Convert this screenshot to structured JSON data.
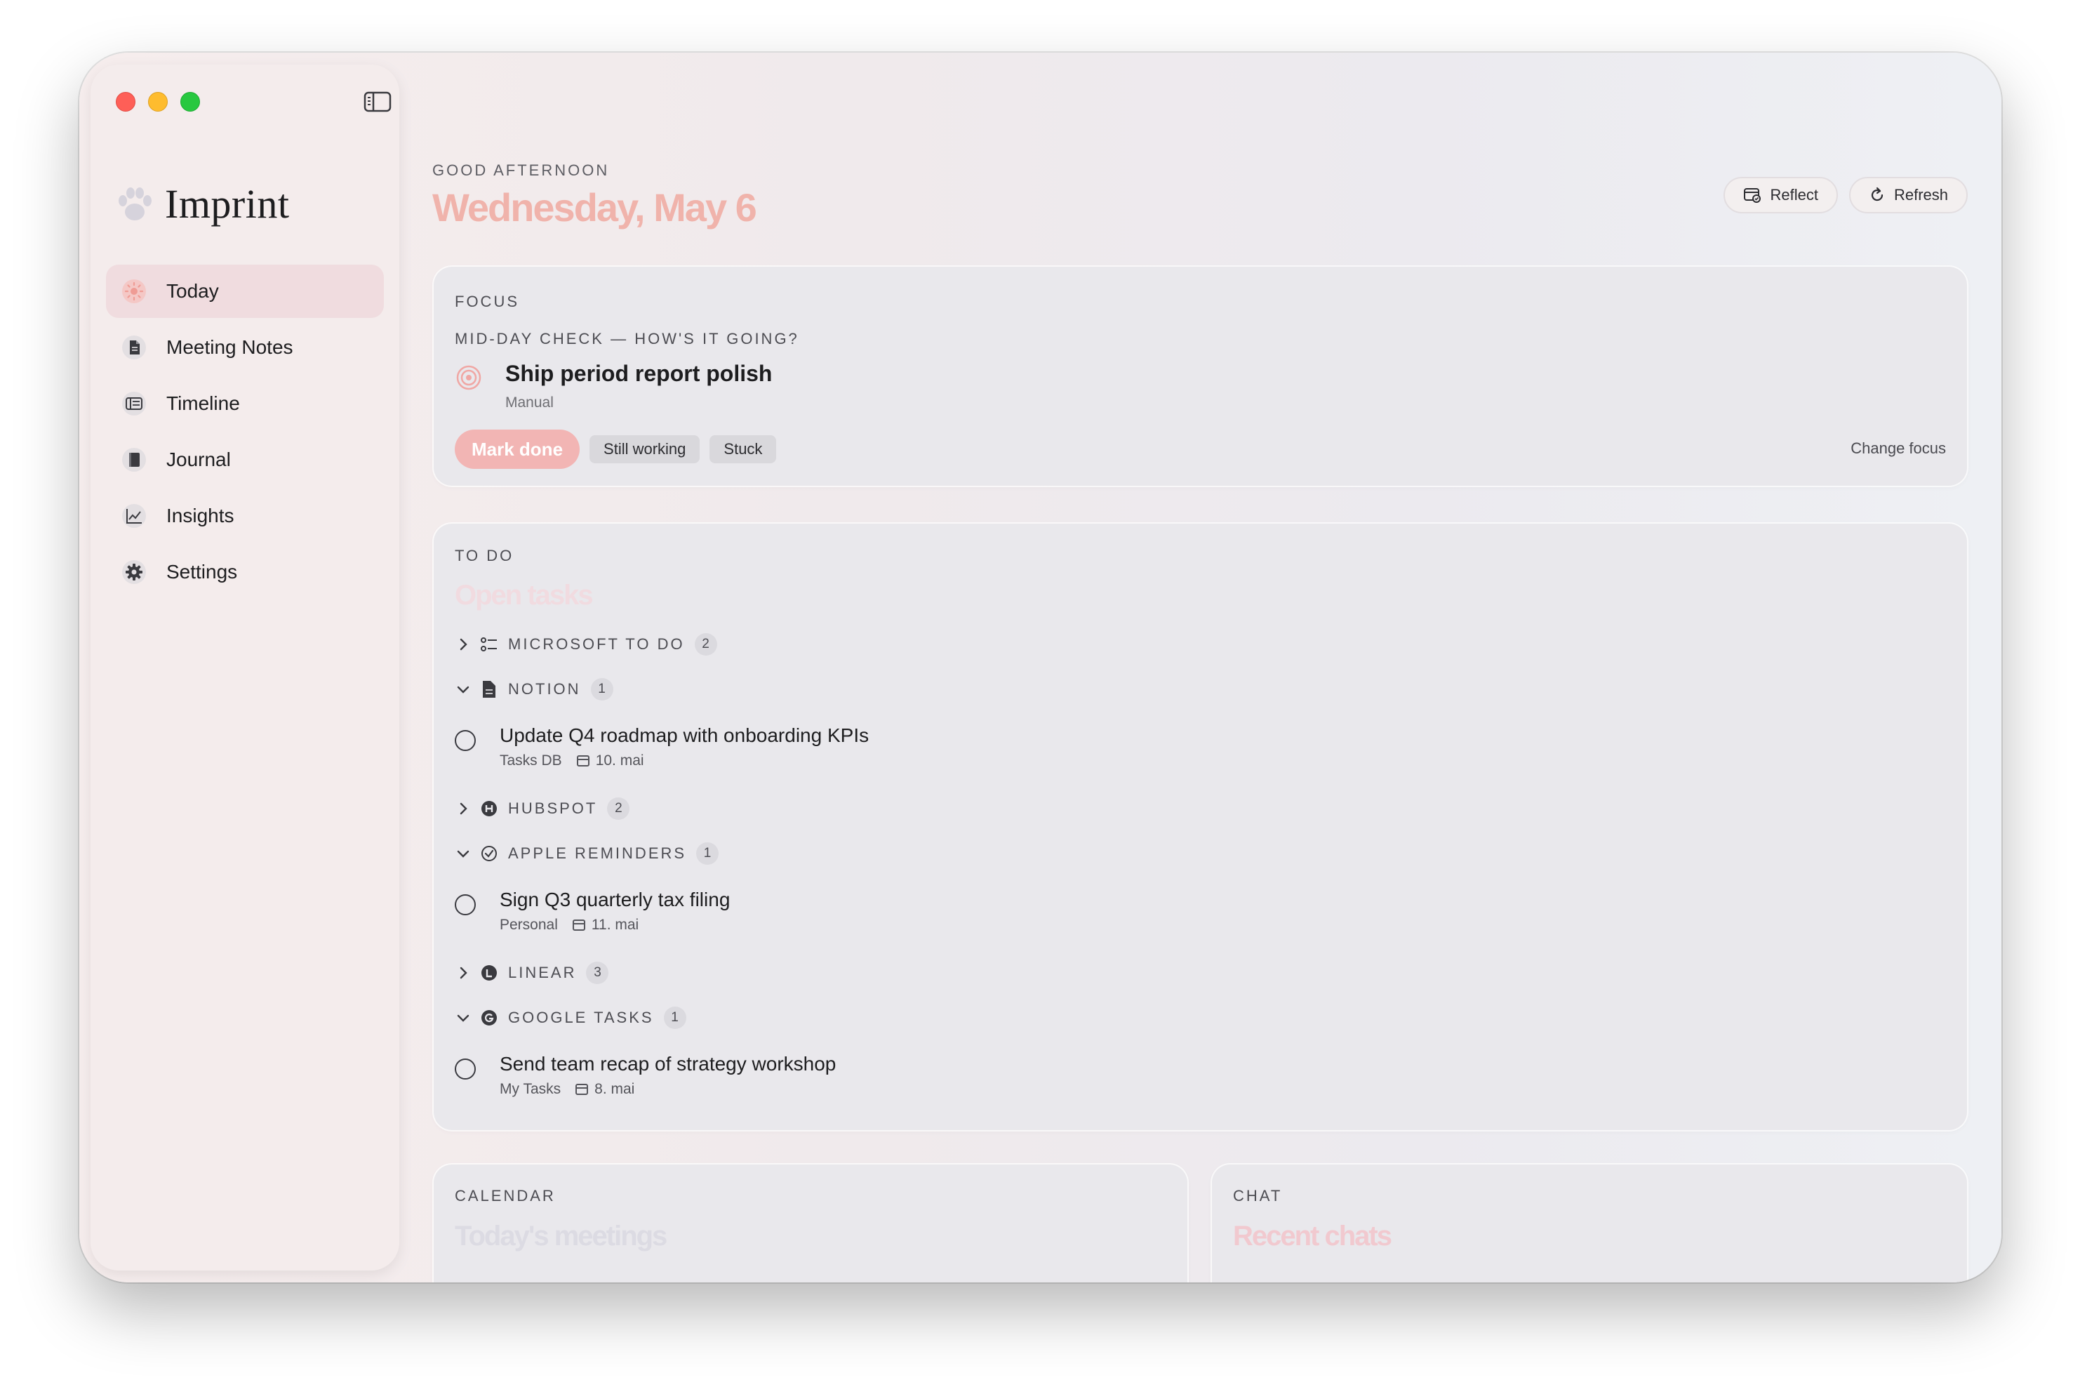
{
  "app": {
    "name": "Imprint"
  },
  "sidebar": {
    "items": [
      {
        "label": "Today",
        "icon": "sun-icon",
        "active": true
      },
      {
        "label": "Meeting Notes",
        "icon": "document-icon"
      },
      {
        "label": "Timeline",
        "icon": "timeline-icon"
      },
      {
        "label": "Journal",
        "icon": "book-icon"
      },
      {
        "label": "Insights",
        "icon": "chart-icon"
      },
      {
        "label": "Settings",
        "icon": "gear-icon"
      }
    ]
  },
  "header": {
    "greeting": "GOOD AFTERNOON",
    "date": "Wednesday, May 6",
    "reflect_label": "Reflect",
    "refresh_label": "Refresh"
  },
  "focus": {
    "label": "FOCUS",
    "subtitle": "MID-DAY CHECK — HOW'S IT GOING?",
    "title": "Ship period report polish",
    "source": "Manual",
    "mark_done_label": "Mark done",
    "still_working_label": "Still working",
    "stuck_label": "Stuck",
    "change_focus_label": "Change focus"
  },
  "todo": {
    "label": "TO DO",
    "title": "Open tasks",
    "groups": [
      {
        "name": "MICROSOFT TO DO",
        "count": "2",
        "expanded": false,
        "icon": "list-icon"
      },
      {
        "name": "NOTION",
        "count": "1",
        "expanded": true,
        "icon": "document-icon",
        "task": {
          "title": "Update Q4 roadmap with onboarding KPIs",
          "list": "Tasks DB",
          "due": "10. mai"
        }
      },
      {
        "name": "HUBSPOT",
        "count": "2",
        "expanded": false,
        "icon": "hubspot-icon"
      },
      {
        "name": "APPLE REMINDERS",
        "count": "1",
        "expanded": true,
        "icon": "checkmark-circle-icon",
        "task": {
          "title": "Sign Q3 quarterly tax filing",
          "list": "Personal",
          "due": "11. mai"
        }
      },
      {
        "name": "LINEAR",
        "count": "3",
        "expanded": false,
        "icon": "linear-icon"
      },
      {
        "name": "GOOGLE TASKS",
        "count": "1",
        "expanded": true,
        "icon": "google-icon",
        "task": {
          "title": "Send team recap of strategy workshop",
          "list": "My Tasks",
          "due": "8. mai"
        }
      }
    ]
  },
  "calendar": {
    "label": "CALENDAR",
    "title": "Today's meetings"
  },
  "chat": {
    "label": "CHAT",
    "title": "Recent chats"
  },
  "colors": {
    "accent": "#f0b3ab",
    "mark_done_bg": "#f2b5b4",
    "active_nav_bg": "#f0dcdf",
    "card_bg": "#e9e8ec"
  }
}
